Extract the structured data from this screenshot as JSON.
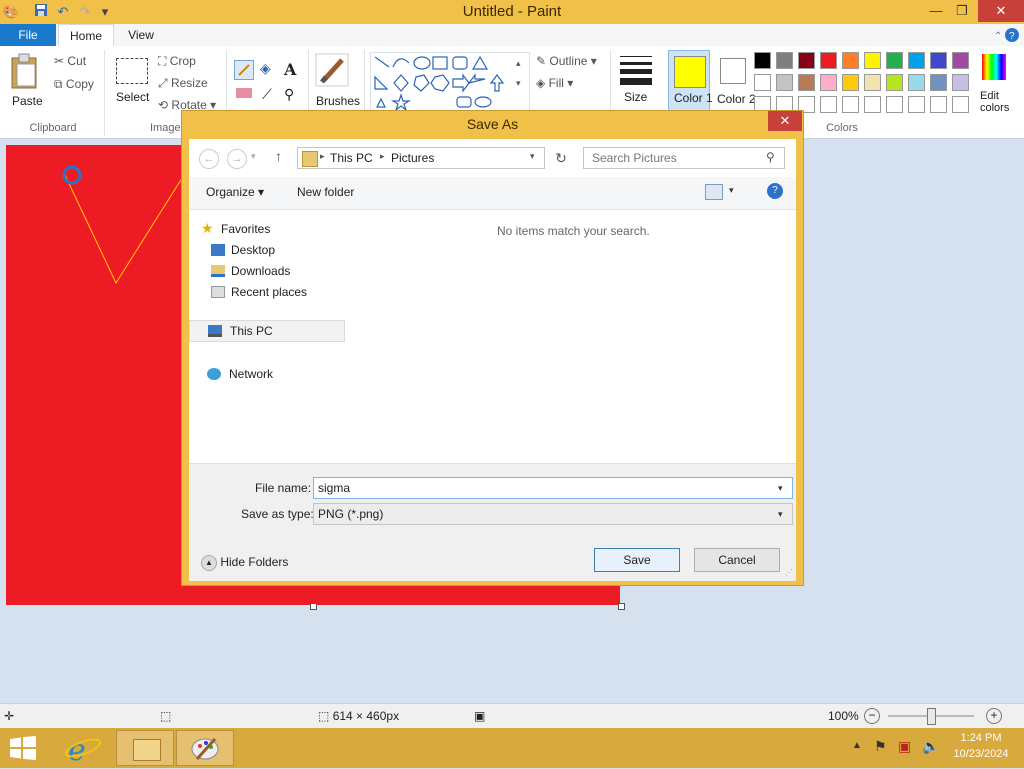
{
  "window": {
    "title": "Untitled - Paint"
  },
  "quick_access": [
    "save-icon",
    "undo-icon",
    "redo-icon",
    "customize-icon"
  ],
  "window_controls": {
    "minimize": "—",
    "maximize": "❐",
    "close": "✕"
  },
  "tabs": {
    "file": "File",
    "home": "Home",
    "view": "View"
  },
  "ribbon": {
    "clipboard": {
      "paste": "Paste",
      "cut": "Cut",
      "copy": "Copy",
      "label": "Clipboard"
    },
    "image": {
      "select": "Select",
      "crop": "Crop",
      "resize": "Resize",
      "rotate": "Rotate",
      "label": "Image"
    },
    "brushes": "Brushes",
    "shapes": {
      "outline": "Outline",
      "fill": "Fill"
    },
    "size": "Size",
    "color1": {
      "label": "Color 1",
      "value": "#ffff00"
    },
    "color2": {
      "label": "Color 2",
      "value": "#ffffff"
    },
    "colors_label": "Colors",
    "edit_colors": "Edit colors",
    "palette_row1": [
      "#000000",
      "#7f7f7f",
      "#880015",
      "#ed1c24",
      "#ff7f27",
      "#fff200",
      "#22b14c",
      "#00a2e8",
      "#3f48cc",
      "#a349a4"
    ],
    "palette_row2": [
      "#ffffff",
      "#c3c3c3",
      "#b97a57",
      "#ffaec9",
      "#ffc90e",
      "#efe4b0",
      "#b5e61d",
      "#99d9ea",
      "#7092be",
      "#c8bfe7"
    ],
    "palette_row3": [
      "#ffffff",
      "#ffffff",
      "#ffffff",
      "#ffffff",
      "#ffffff",
      "#ffffff",
      "#ffffff",
      "#ffffff",
      "#ffffff",
      "#ffffff"
    ]
  },
  "canvas": {
    "color": "#ed1c24",
    "line_color": "#ffcc00"
  },
  "dialog": {
    "title": "Save As",
    "close": "✕",
    "breadcrumb": [
      "This PC",
      "Pictures"
    ],
    "search_placeholder": "Search Pictures",
    "organize": "Organize",
    "new_folder": "New folder",
    "nav": {
      "favorites": "Favorites",
      "desktop": "Desktop",
      "downloads": "Downloads",
      "recent": "Recent places",
      "this_pc": "This PC",
      "network": "Network"
    },
    "empty_message": "No items match your search.",
    "file_name_label": "File name:",
    "file_name_value": "sigma",
    "save_type_label": "Save as type:",
    "save_type_value": "PNG (*.png)",
    "hide_folders": "Hide Folders",
    "save": "Save",
    "cancel": "Cancel"
  },
  "status": {
    "dimensions": "614 × 460px",
    "zoom": "100%",
    "zoom_level": 1.0
  },
  "taskbar": {
    "time": "1:24 PM",
    "date": "10/23/2024"
  }
}
